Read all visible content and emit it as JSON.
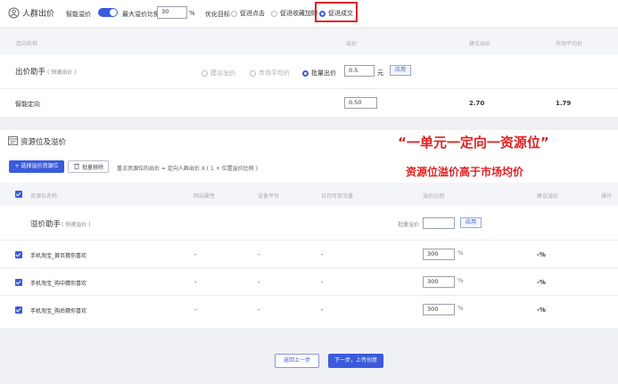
{
  "top": {
    "title": "人群出价",
    "smart_premium_label": "智能溢价",
    "max_ratio_label": "最大溢价比例",
    "max_ratio_value": "30",
    "percent": "%",
    "goal_label": "优化目标",
    "goal_options": [
      "促进点击",
      "促进收藏加购",
      "促进成交"
    ],
    "goal_selected": "促进成交"
  },
  "panel1": {
    "headers": {
      "name": "定向名称",
      "bid": "出价",
      "suggested": "建议出价",
      "market": "市场平均价"
    },
    "helper": {
      "title": "出价助手",
      "subtitle": "( 快速出价 )",
      "options": [
        "建议出价",
        "市场平均价",
        "批量出价"
      ],
      "selected": "批量出价",
      "value": "0.5",
      "unit": "元",
      "apply": "应用"
    },
    "row": {
      "name": "智能定向",
      "bid": "0.50",
      "suggested": "2.70",
      "market": "1.79"
    }
  },
  "panel2": {
    "title": "资源位及溢价",
    "annotation1": "“一单元一定向一资源位”",
    "annotation2": "资源位溢价高于市场均价",
    "add_button": "+ 选择溢价资源位",
    "remove_button": "批量移除",
    "formula": "重点资源位的出价 = 定向人群出价 X ( 1 + 位置溢价比例 )",
    "headers": {
      "name": "资源位名称",
      "attr": "网站属性",
      "device": "设备平台",
      "traffic": "日均可竞流量",
      "ratio": "溢价比例",
      "suggested": "建议溢价",
      "action": "操作"
    },
    "helper": {
      "title": "溢价助手",
      "subtitle": "( 快速溢价 )",
      "label": "批量溢价",
      "value": "",
      "apply": "应用"
    },
    "rows": [
      {
        "name": "手机淘宝_首页猜你喜欢",
        "attr": "-",
        "device": "-",
        "traffic": "-",
        "ratio": "300",
        "unit": "%",
        "suggested": "-%"
      },
      {
        "name": "手机淘宝_购中猜你喜欢",
        "attr": "-",
        "device": "-",
        "traffic": "-",
        "ratio": "300",
        "unit": "%",
        "suggested": "-%"
      },
      {
        "name": "手机淘宝_购后猜你喜欢",
        "attr": "-",
        "device": "-",
        "traffic": "-",
        "ratio": "300",
        "unit": "%",
        "suggested": "-%"
      }
    ]
  },
  "footer": {
    "back": "返回上一步",
    "next": "下一步，上传创意"
  },
  "colors": {
    "accent": "#3b5bdb",
    "annotation": "#e02020"
  }
}
